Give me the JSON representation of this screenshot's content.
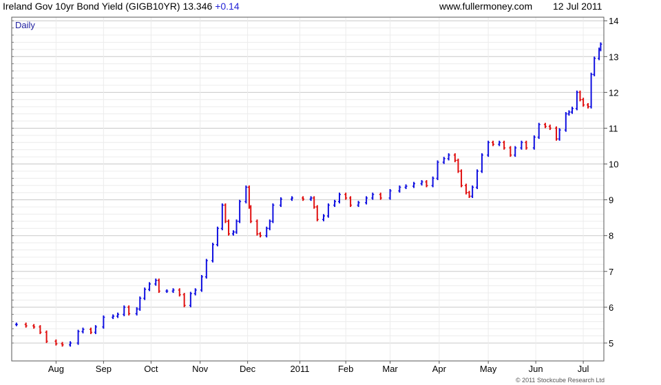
{
  "header": {
    "title": "Ireland Gov 10yr Bond Yield (GIGB10YR)",
    "last": "13.346",
    "change": "+0.14",
    "site": "www.fullermoney.com",
    "date": "12 Jul 2011"
  },
  "footer": {
    "copyright": "© 2011 Stockcube Research Ltd"
  },
  "colors": {
    "up": "#1010e0",
    "down": "#e01010",
    "grid": "#d6d6d6",
    "label": "#2020a0"
  },
  "chart_data": {
    "type": "bar",
    "period_label": "Daily",
    "y_axis": {
      "position": "right",
      "min": 4.5,
      "max": 14.1,
      "ticks": [
        5,
        6,
        7,
        8,
        9,
        10,
        11,
        12,
        13,
        14
      ]
    },
    "x_tick_labels": [
      "Aug",
      "Sep",
      "Oct",
      "Nov",
      "Dec",
      "2011",
      "Feb",
      "Mar",
      "Apr",
      "May",
      "Jun",
      "Jul"
    ],
    "x_tick_dates": [
      "2010-08-02",
      "2010-09-01",
      "2010-10-01",
      "2010-11-01",
      "2010-12-01",
      "2011-01-03",
      "2011-02-01",
      "2011-03-01",
      "2011-04-01",
      "2011-05-02",
      "2011-06-01",
      "2011-07-01"
    ],
    "grid": true,
    "series": [
      {
        "values": [
          {
            "date": "2010-07-08",
            "value": 5.52
          },
          {
            "date": "2010-07-14",
            "value": 5.48
          },
          {
            "date": "2010-07-19",
            "value": 5.45
          },
          {
            "date": "2010-07-23",
            "value": 5.3
          },
          {
            "date": "2010-07-27",
            "value": 5.05
          },
          {
            "date": "2010-08-02",
            "value": 4.98
          },
          {
            "date": "2010-08-06",
            "value": 4.95
          },
          {
            "date": "2010-08-11",
            "value": 5.0
          },
          {
            "date": "2010-08-16",
            "value": 5.32
          },
          {
            "date": "2010-08-19",
            "value": 5.38
          },
          {
            "date": "2010-08-24",
            "value": 5.3
          },
          {
            "date": "2010-08-27",
            "value": 5.45
          },
          {
            "date": "2010-09-01",
            "value": 5.72
          },
          {
            "date": "2010-09-07",
            "value": 5.75
          },
          {
            "date": "2010-09-10",
            "value": 5.8
          },
          {
            "date": "2010-09-14",
            "value": 6.0
          },
          {
            "date": "2010-09-17",
            "value": 5.82
          },
          {
            "date": "2010-09-22",
            "value": 5.95
          },
          {
            "date": "2010-09-24",
            "value": 6.25
          },
          {
            "date": "2010-09-27",
            "value": 6.5
          },
          {
            "date": "2010-09-30",
            "value": 6.65
          },
          {
            "date": "2010-10-04",
            "value": 6.75
          },
          {
            "date": "2010-10-06",
            "value": 6.45
          },
          {
            "date": "2010-10-11",
            "value": 6.45
          },
          {
            "date": "2010-10-15",
            "value": 6.48
          },
          {
            "date": "2010-10-19",
            "value": 6.35
          },
          {
            "date": "2010-10-22",
            "value": 6.05
          },
          {
            "date": "2010-10-26",
            "value": 6.38
          },
          {
            "date": "2010-10-29",
            "value": 6.48
          },
          {
            "date": "2010-11-02",
            "value": 6.85
          },
          {
            "date": "2010-11-05",
            "value": 7.3
          },
          {
            "date": "2010-11-09",
            "value": 7.75
          },
          {
            "date": "2010-11-12",
            "value": 8.2
          },
          {
            "date": "2010-11-15",
            "value": 8.85
          },
          {
            "date": "2010-11-17",
            "value": 8.4
          },
          {
            "date": "2010-11-19",
            "value": 8.05
          },
          {
            "date": "2010-11-22",
            "value": 8.1
          },
          {
            "date": "2010-11-24",
            "value": 8.4
          },
          {
            "date": "2010-11-26",
            "value": 8.95
          },
          {
            "date": "2010-11-30",
            "value": 9.35
          },
          {
            "date": "2010-12-02",
            "value": 8.8
          },
          {
            "date": "2010-12-03",
            "value": 8.4
          },
          {
            "date": "2010-12-07",
            "value": 8.05
          },
          {
            "date": "2010-12-09",
            "value": 8.0
          },
          {
            "date": "2010-12-13",
            "value": 8.2
          },
          {
            "date": "2010-12-15",
            "value": 8.4
          },
          {
            "date": "2010-12-17",
            "value": 8.85
          },
          {
            "date": "2010-12-22",
            "value": 9.02
          },
          {
            "date": "2010-12-29",
            "value": 9.05
          },
          {
            "date": "2011-01-05",
            "value": 9.02
          },
          {
            "date": "2011-01-10",
            "value": 9.05
          },
          {
            "date": "2011-01-12",
            "value": 8.8
          },
          {
            "date": "2011-01-14",
            "value": 8.45
          },
          {
            "date": "2011-01-18",
            "value": 8.55
          },
          {
            "date": "2011-01-21",
            "value": 8.85
          },
          {
            "date": "2011-01-25",
            "value": 8.95
          },
          {
            "date": "2011-01-28",
            "value": 9.15
          },
          {
            "date": "2011-02-01",
            "value": 9.05
          },
          {
            "date": "2011-02-04",
            "value": 8.85
          },
          {
            "date": "2011-02-09",
            "value": 8.92
          },
          {
            "date": "2011-02-14",
            "value": 9.05
          },
          {
            "date": "2011-02-18",
            "value": 9.15
          },
          {
            "date": "2011-02-23",
            "value": 9.05
          },
          {
            "date": "2011-03-01",
            "value": 9.25
          },
          {
            "date": "2011-03-07",
            "value": 9.35
          },
          {
            "date": "2011-03-11",
            "value": 9.38
          },
          {
            "date": "2011-03-16",
            "value": 9.45
          },
          {
            "date": "2011-03-21",
            "value": 9.5
          },
          {
            "date": "2011-03-24",
            "value": 9.4
          },
          {
            "date": "2011-03-28",
            "value": 9.6
          },
          {
            "date": "2011-03-31",
            "value": 10.05
          },
          {
            "date": "2011-04-04",
            "value": 10.15
          },
          {
            "date": "2011-04-07",
            "value": 10.25
          },
          {
            "date": "2011-04-11",
            "value": 10.1
          },
          {
            "date": "2011-04-13",
            "value": 9.8
          },
          {
            "date": "2011-04-15",
            "value": 9.4
          },
          {
            "date": "2011-04-18",
            "value": 9.2
          },
          {
            "date": "2011-04-20",
            "value": 9.1
          },
          {
            "date": "2011-04-22",
            "value": 9.35
          },
          {
            "date": "2011-04-25",
            "value": 9.8
          },
          {
            "date": "2011-04-28",
            "value": 10.25
          },
          {
            "date": "2011-05-02",
            "value": 10.6
          },
          {
            "date": "2011-05-05",
            "value": 10.55
          },
          {
            "date": "2011-05-09",
            "value": 10.6
          },
          {
            "date": "2011-05-12",
            "value": 10.45
          },
          {
            "date": "2011-05-16",
            "value": 10.25
          },
          {
            "date": "2011-05-19",
            "value": 10.45
          },
          {
            "date": "2011-05-23",
            "value": 10.6
          },
          {
            "date": "2011-05-26",
            "value": 10.45
          },
          {
            "date": "2011-05-31",
            "value": 10.75
          },
          {
            "date": "2011-06-03",
            "value": 11.1
          },
          {
            "date": "2011-06-07",
            "value": 11.05
          },
          {
            "date": "2011-06-10",
            "value": 11.0
          },
          {
            "date": "2011-06-14",
            "value": 10.7
          },
          {
            "date": "2011-06-16",
            "value": 10.95
          },
          {
            "date": "2011-06-20",
            "value": 11.4
          },
          {
            "date": "2011-06-22",
            "value": 11.45
          },
          {
            "date": "2011-06-24",
            "value": 11.55
          },
          {
            "date": "2011-06-27",
            "value": 12.0
          },
          {
            "date": "2011-06-29",
            "value": 11.8
          },
          {
            "date": "2011-07-01",
            "value": 11.65
          },
          {
            "date": "2011-07-04",
            "value": 11.6
          },
          {
            "date": "2011-07-06",
            "value": 12.5
          },
          {
            "date": "2011-07-08",
            "value": 12.95
          },
          {
            "date": "2011-07-11",
            "value": 13.2
          },
          {
            "date": "2011-07-12",
            "value": 13.346
          }
        ]
      }
    ]
  }
}
